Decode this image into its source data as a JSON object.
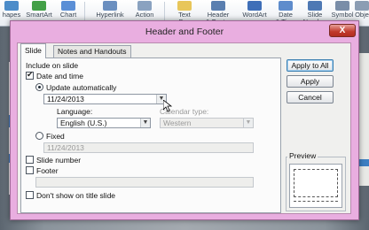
{
  "ribbon": {
    "items": [
      {
        "label": "hapes",
        "color": "#4c8cc9"
      },
      {
        "label": "SmartArt",
        "color": "#43a047"
      },
      {
        "label": "Chart",
        "color": "#5b8fd6"
      },
      {
        "label": "Hyperlink",
        "color": "#6b8fbf"
      },
      {
        "label": "Action",
        "color": "#8aa2c0"
      },
      {
        "label": "Text\nBox",
        "color": "#e8c65a"
      },
      {
        "label": "Header\n& Footer",
        "color": "#5a7fb0"
      },
      {
        "label": "WordArt",
        "color": "#3f6fb8"
      },
      {
        "label": "Date\n& Time",
        "color": "#5e8ccc"
      },
      {
        "label": "Slide\nNumber",
        "color": "#4e79b4"
      },
      {
        "label": "Symbol",
        "color": "#7a8ea8"
      },
      {
        "label": "Obje",
        "color": "#8b9db3"
      }
    ]
  },
  "dialog": {
    "title": "Header and Footer",
    "close_label": "X",
    "tabs": [
      "Slide",
      "Notes and Handouts"
    ],
    "include_on_slide": "Include on slide",
    "date_and_time": {
      "label": "Date and time",
      "checked": true
    },
    "update_automatically": {
      "label": "Update automatically",
      "selected": true
    },
    "date_value": "11/24/2013",
    "language_label": "Language:",
    "language_value": "English (U.S.)",
    "calendar_type_label": "Calendar type:",
    "calendar_type_value": "Western",
    "fixed": {
      "label": "Fixed",
      "selected": false,
      "value": "11/24/2013"
    },
    "slide_number": {
      "label": "Slide number",
      "checked": false
    },
    "footer": {
      "label": "Footer",
      "checked": false,
      "value": ""
    },
    "dont_show_title": {
      "label": "Don't show on title slide",
      "checked": false
    },
    "buttons": {
      "apply_to_all": "Apply to All",
      "apply": "Apply",
      "cancel": "Cancel"
    },
    "preview_label": "Preview"
  },
  "colors": {
    "dialog_frame": "#e9aee0",
    "close_button": "#c0392b",
    "slide_accent": "#3d7fc1"
  }
}
